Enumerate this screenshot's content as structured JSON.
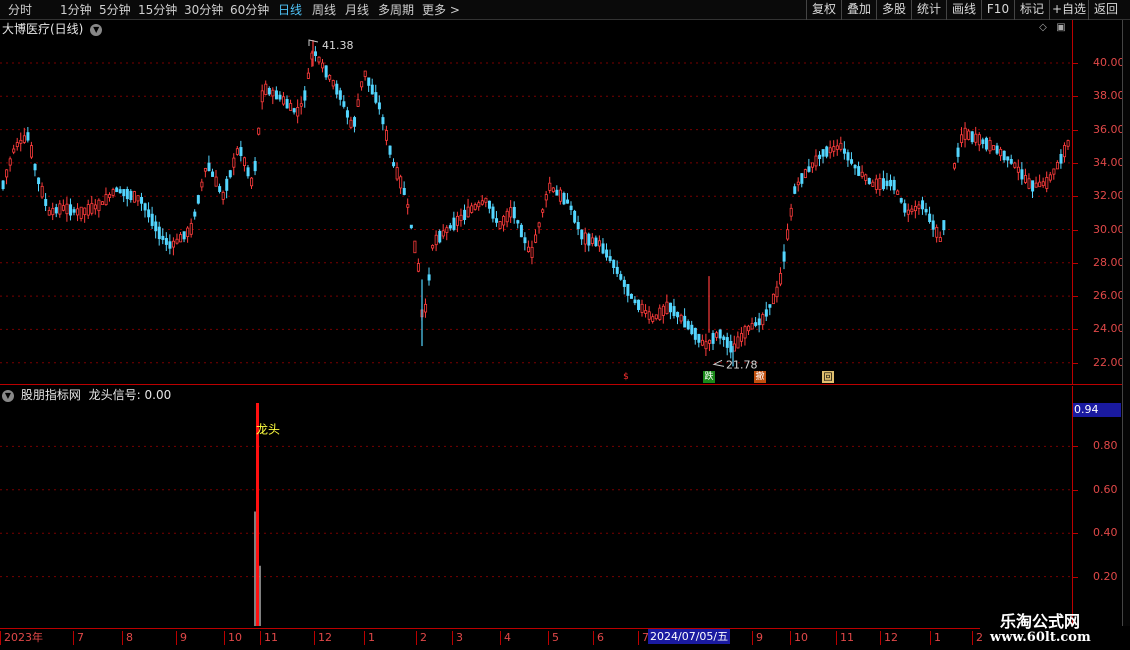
{
  "toolbar": {
    "periods": [
      "分时",
      "1分钟",
      "5分钟",
      "15分钟",
      "30分钟",
      "60分钟",
      "日线",
      "周线",
      "月线",
      "多周期",
      "更多 >"
    ],
    "active_period": "日线",
    "buttons": [
      "复权",
      "叠加",
      "多股",
      "统计",
      "画线",
      "F10",
      "标记",
      "+自选",
      "返回"
    ]
  },
  "main_chart": {
    "stock_name": "大博医疗(日线)",
    "high_label": "41.38",
    "low_label": "21.78",
    "price_axis": [
      "40.00",
      "38.00",
      "36.00",
      "34.00",
      "32.00",
      "30.00",
      "28.00",
      "26.00",
      "24.00",
      "22.00"
    ],
    "signals": [
      {
        "label": "$",
        "color": "#ff3030",
        "bg": "#000000"
      },
      {
        "label": "跌",
        "color": "#ffffff",
        "bg": "#1a8a1a"
      },
      {
        "label": "撤",
        "color": "#ffffff",
        "bg": "#c05010"
      },
      {
        "label": "回",
        "color": "#000000",
        "bg": "#e0c070"
      }
    ]
  },
  "sub_chart": {
    "indicator_name": "股朋指标网",
    "signal_text": "龙头信号: 0.00",
    "current_value": "0.94",
    "axis": [
      "0.80",
      "0.60",
      "0.40",
      "0.20"
    ],
    "annotation": "龙头"
  },
  "date_axis": {
    "labels": [
      "2023年",
      "7",
      "8",
      "9",
      "10",
      "11",
      "12",
      "1",
      "2",
      "3",
      "4",
      "5",
      "6",
      "7",
      "9",
      "10",
      "11",
      "12",
      "1",
      "2"
    ],
    "cursor_date": "2024/07/05/五"
  },
  "watermark": {
    "line1": "乐淘公式网",
    "line2": "www.60lt.com"
  },
  "colors": {
    "up": "#ff3c3c",
    "down": "#54d6ff",
    "axis": "#e04848",
    "grid": "#7a0000"
  }
}
